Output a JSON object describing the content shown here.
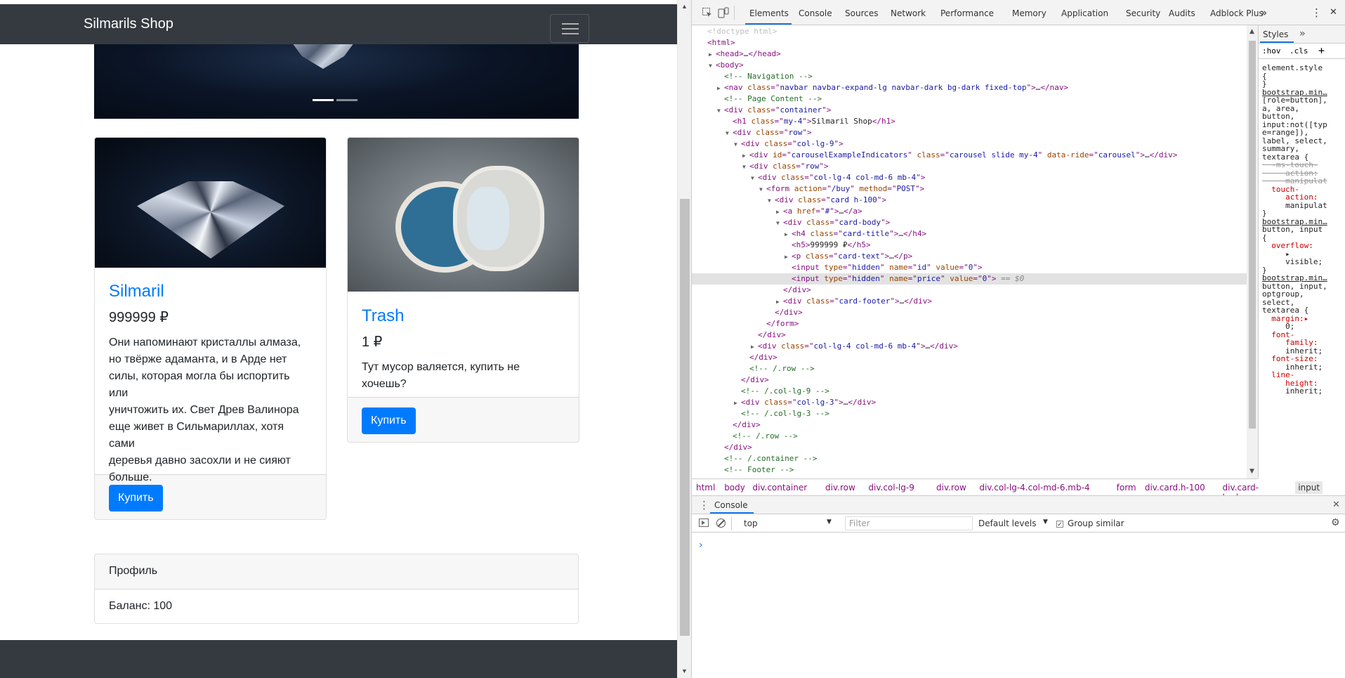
{
  "page": {
    "brand": "Silmarils Shop",
    "products": [
      {
        "title": "Silmaril",
        "price": "999999 ₽",
        "text_lines": [
          "Они напоминают кристаллы алмаза,",
          "но твёрже адаманта, и в Арде нет",
          "силы, которая могла бы испортить или",
          "уничтожить их. Свет Древ Валинора",
          "еще живет в Сильмариллах, хотя сами",
          "деревья давно засохли и не сияют",
          "больше."
        ],
        "buy_label": "Купить"
      },
      {
        "title": "Trash",
        "price": "1 ₽",
        "text_lines": [
          "Тут мусор валяется, купить не хочешь?"
        ],
        "buy_label": "Купить"
      }
    ],
    "profile": {
      "header": "Профиль",
      "balance": "Баланс: 100"
    }
  },
  "devtools": {
    "tabs": [
      "Elements",
      "Console",
      "Sources",
      "Network",
      "Performance",
      "Memory",
      "Application",
      "Security",
      "Audits",
      "Adblock Plus"
    ],
    "more_tabs": "»",
    "menu": "⋮",
    "close": "✕",
    "elements_lines": [
      {
        "tri": "",
        "indent": 0,
        "parts": [
          [
            "doc",
            "<!doctype html>"
          ]
        ]
      },
      {
        "tri": "",
        "indent": 0,
        "parts": [
          [
            "tag",
            "<html>"
          ]
        ]
      },
      {
        "tri": "▶",
        "indent": 1,
        "parts": [
          [
            "tag",
            "<head>"
          ],
          [
            "txt",
            "…"
          ],
          [
            "tag",
            "</head>"
          ]
        ]
      },
      {
        "tri": "▼",
        "indent": 1,
        "parts": [
          [
            "tag",
            "<body>"
          ]
        ]
      },
      {
        "tri": "",
        "indent": 2,
        "parts": [
          [
            "com",
            "<!-- Navigation -->"
          ]
        ]
      },
      {
        "tri": "▶",
        "indent": 2,
        "parts": [
          [
            "tag",
            "<nav "
          ],
          [
            "attr",
            "class"
          ],
          [
            "tag",
            "=\""
          ],
          [
            "val",
            "navbar navbar-expand-lg navbar-dark bg-dark fixed-top"
          ],
          [
            "tag",
            "\">"
          ],
          [
            "txt",
            "…"
          ],
          [
            "tag",
            "</nav>"
          ]
        ]
      },
      {
        "tri": "",
        "indent": 2,
        "parts": [
          [
            "com",
            "<!-- Page Content -->"
          ]
        ]
      },
      {
        "tri": "▼",
        "indent": 2,
        "parts": [
          [
            "tag",
            "<div "
          ],
          [
            "attr",
            "class"
          ],
          [
            "tag",
            "=\""
          ],
          [
            "val",
            "container"
          ],
          [
            "tag",
            "\">"
          ]
        ]
      },
      {
        "tri": "",
        "indent": 3,
        "parts": [
          [
            "tag",
            "<h1 "
          ],
          [
            "attr",
            "class"
          ],
          [
            "tag",
            "=\""
          ],
          [
            "val",
            "my-4"
          ],
          [
            "tag",
            "\">"
          ],
          [
            "txt",
            "Silmaril Shop"
          ],
          [
            "tag",
            "</h1>"
          ]
        ]
      },
      {
        "tri": "▼",
        "indent": 3,
        "parts": [
          [
            "tag",
            "<div "
          ],
          [
            "attr",
            "class"
          ],
          [
            "tag",
            "=\""
          ],
          [
            "val",
            "row"
          ],
          [
            "tag",
            "\">"
          ]
        ]
      },
      {
        "tri": "▼",
        "indent": 4,
        "parts": [
          [
            "tag",
            "<div "
          ],
          [
            "attr",
            "class"
          ],
          [
            "tag",
            "=\""
          ],
          [
            "val",
            "col-lg-9"
          ],
          [
            "tag",
            "\">"
          ]
        ]
      },
      {
        "tri": "▶",
        "indent": 5,
        "parts": [
          [
            "tag",
            "<div "
          ],
          [
            "attr",
            "id"
          ],
          [
            "tag",
            "=\""
          ],
          [
            "val",
            "carouselExampleIndicators"
          ],
          [
            "tag",
            "\" "
          ],
          [
            "attr",
            "class"
          ],
          [
            "tag",
            "=\""
          ],
          [
            "val",
            "carousel slide my-4"
          ],
          [
            "tag",
            "\" "
          ],
          [
            "attr",
            "data-ride"
          ],
          [
            "tag",
            "=\""
          ],
          [
            "val",
            "carousel"
          ],
          [
            "tag",
            "\">"
          ],
          [
            "txt",
            "…"
          ],
          [
            "tag",
            "</div>"
          ]
        ]
      },
      {
        "tri": "▼",
        "indent": 5,
        "parts": [
          [
            "tag",
            "<div "
          ],
          [
            "attr",
            "class"
          ],
          [
            "tag",
            "=\""
          ],
          [
            "val",
            "row"
          ],
          [
            "tag",
            "\">"
          ]
        ]
      },
      {
        "tri": "▼",
        "indent": 6,
        "parts": [
          [
            "tag",
            "<div "
          ],
          [
            "attr",
            "class"
          ],
          [
            "tag",
            "=\""
          ],
          [
            "val",
            "col-lg-4 col-md-6 mb-4"
          ],
          [
            "tag",
            "\">"
          ]
        ]
      },
      {
        "tri": "▼",
        "indent": 7,
        "parts": [
          [
            "tag",
            "<form "
          ],
          [
            "attr",
            "action"
          ],
          [
            "tag",
            "=\""
          ],
          [
            "val",
            "/buy"
          ],
          [
            "tag",
            "\" "
          ],
          [
            "attr",
            "method"
          ],
          [
            "tag",
            "=\""
          ],
          [
            "val",
            "POST"
          ],
          [
            "tag",
            "\">"
          ]
        ]
      },
      {
        "tri": "▼",
        "indent": 8,
        "parts": [
          [
            "tag",
            "<div "
          ],
          [
            "attr",
            "class"
          ],
          [
            "tag",
            "=\""
          ],
          [
            "val",
            "card h-100"
          ],
          [
            "tag",
            "\">"
          ]
        ]
      },
      {
        "tri": "▶",
        "indent": 9,
        "parts": [
          [
            "tag",
            "<a "
          ],
          [
            "attr",
            "href"
          ],
          [
            "tag",
            "=\""
          ],
          [
            "val",
            "#"
          ],
          [
            "tag",
            "\">"
          ],
          [
            "txt",
            "…"
          ],
          [
            "tag",
            "</a>"
          ]
        ]
      },
      {
        "tri": "▼",
        "indent": 9,
        "parts": [
          [
            "tag",
            "<div "
          ],
          [
            "attr",
            "class"
          ],
          [
            "tag",
            "=\""
          ],
          [
            "val",
            "card-body"
          ],
          [
            "tag",
            "\">"
          ]
        ]
      },
      {
        "tri": "▶",
        "indent": 10,
        "parts": [
          [
            "tag",
            "<h4 "
          ],
          [
            "attr",
            "class"
          ],
          [
            "tag",
            "=\""
          ],
          [
            "val",
            "card-title"
          ],
          [
            "tag",
            "\">"
          ],
          [
            "txt",
            "…"
          ],
          [
            "tag",
            "</h4>"
          ]
        ]
      },
      {
        "tri": "",
        "indent": 10,
        "parts": [
          [
            "tag",
            "<h5>"
          ],
          [
            "txt",
            "999999 ₽"
          ],
          [
            "tag",
            "</h5>"
          ]
        ]
      },
      {
        "tri": "▶",
        "indent": 10,
        "parts": [
          [
            "tag",
            "<p "
          ],
          [
            "attr",
            "class"
          ],
          [
            "tag",
            "=\""
          ],
          [
            "val",
            "card-text"
          ],
          [
            "tag",
            "\">"
          ],
          [
            "txt",
            "…"
          ],
          [
            "tag",
            "</p>"
          ]
        ]
      },
      {
        "tri": "",
        "indent": 10,
        "parts": [
          [
            "tag",
            "<input "
          ],
          [
            "attr",
            "type"
          ],
          [
            "tag",
            "=\""
          ],
          [
            "val",
            "hidden"
          ],
          [
            "tag",
            "\" "
          ],
          [
            "attr",
            "name"
          ],
          [
            "tag",
            "=\""
          ],
          [
            "val",
            "id"
          ],
          [
            "tag",
            "\" "
          ],
          [
            "attr",
            "value"
          ],
          [
            "tag",
            "=\""
          ],
          [
            "val",
            "0"
          ],
          [
            "tag",
            "\">"
          ]
        ]
      },
      {
        "tri": "",
        "indent": 10,
        "sel": true,
        "parts": [
          [
            "tag",
            "<input "
          ],
          [
            "attr",
            "type"
          ],
          [
            "tag",
            "=\""
          ],
          [
            "val",
            "hidden"
          ],
          [
            "tag",
            "\" "
          ],
          [
            "attr",
            "name"
          ],
          [
            "tag",
            "=\""
          ],
          [
            "val",
            "price"
          ],
          [
            "tag",
            "\" "
          ],
          [
            "attr",
            "value"
          ],
          [
            "tag",
            "=\""
          ],
          [
            "val",
            "0"
          ],
          [
            "tag",
            "\">"
          ],
          [
            "eq",
            " == $0"
          ]
        ]
      },
      {
        "tri": "",
        "indent": 9,
        "parts": [
          [
            "tag",
            "</div>"
          ]
        ]
      },
      {
        "tri": "▶",
        "indent": 9,
        "parts": [
          [
            "tag",
            "<div "
          ],
          [
            "attr",
            "class"
          ],
          [
            "tag",
            "=\""
          ],
          [
            "val",
            "card-footer"
          ],
          [
            "tag",
            "\">"
          ],
          [
            "txt",
            "…"
          ],
          [
            "tag",
            "</div>"
          ]
        ]
      },
      {
        "tri": "",
        "indent": 8,
        "parts": [
          [
            "tag",
            "</div>"
          ]
        ]
      },
      {
        "tri": "",
        "indent": 7,
        "parts": [
          [
            "tag",
            "</form>"
          ]
        ]
      },
      {
        "tri": "",
        "indent": 6,
        "parts": [
          [
            "tag",
            "</div>"
          ]
        ]
      },
      {
        "tri": "▶",
        "indent": 6,
        "parts": [
          [
            "tag",
            "<div "
          ],
          [
            "attr",
            "class"
          ],
          [
            "tag",
            "=\""
          ],
          [
            "val",
            "col-lg-4 col-md-6 mb-4"
          ],
          [
            "tag",
            "\">"
          ],
          [
            "txt",
            "…"
          ],
          [
            "tag",
            "</div>"
          ]
        ]
      },
      {
        "tri": "",
        "indent": 5,
        "parts": [
          [
            "tag",
            "</div>"
          ]
        ]
      },
      {
        "tri": "",
        "indent": 5,
        "parts": [
          [
            "com",
            "<!-- /.row -->"
          ]
        ]
      },
      {
        "tri": "",
        "indent": 4,
        "parts": [
          [
            "tag",
            "</div>"
          ]
        ]
      },
      {
        "tri": "",
        "indent": 4,
        "parts": [
          [
            "com",
            "<!-- /.col-lg-9 -->"
          ]
        ]
      },
      {
        "tri": "▶",
        "indent": 4,
        "parts": [
          [
            "tag",
            "<div "
          ],
          [
            "attr",
            "class"
          ],
          [
            "tag",
            "=\""
          ],
          [
            "val",
            "col-lg-3"
          ],
          [
            "tag",
            "\">"
          ],
          [
            "txt",
            "…"
          ],
          [
            "tag",
            "</div>"
          ]
        ]
      },
      {
        "tri": "",
        "indent": 4,
        "parts": [
          [
            "com",
            "<!-- /.col-lg-3 -->"
          ]
        ]
      },
      {
        "tri": "",
        "indent": 3,
        "parts": [
          [
            "tag",
            "</div>"
          ]
        ]
      },
      {
        "tri": "",
        "indent": 3,
        "parts": [
          [
            "com",
            "<!-- /.row -->"
          ]
        ]
      },
      {
        "tri": "",
        "indent": 2,
        "parts": [
          [
            "tag",
            "</div>"
          ]
        ]
      },
      {
        "tri": "",
        "indent": 2,
        "parts": [
          [
            "com",
            "<!-- /.container -->"
          ]
        ]
      },
      {
        "tri": "",
        "indent": 2,
        "parts": [
          [
            "com",
            "<!-- Footer -->"
          ]
        ]
      }
    ],
    "styles": {
      "tab": "Styles",
      "more": "»",
      "hov": ":hov",
      "cls": ".cls",
      "plus": "+"
    },
    "style_lines": [
      [
        "txt",
        "element.style"
      ],
      [
        "txt",
        "{"
      ],
      [
        "txt",
        "}"
      ],
      [
        "link",
        "bootstrap.min…"
      ],
      [
        "txt",
        "[role=button],"
      ],
      [
        "txt",
        "a, area,"
      ],
      [
        "txt",
        "button,"
      ],
      [
        "txt",
        "input:not([typ"
      ],
      [
        "txt",
        "e=range]),"
      ],
      [
        "txt",
        "label, select,"
      ],
      [
        "txt",
        "summary,"
      ],
      [
        "txt",
        "textarea {"
      ],
      [
        "strike",
        "  -ms-touch-"
      ],
      [
        "strike",
        "     action:"
      ],
      [
        "strike",
        "     manipulat"
      ],
      [
        "prop",
        "  touch-"
      ],
      [
        "prop",
        "     action:"
      ],
      [
        "txt",
        "     manipulat"
      ],
      [
        "txt",
        "}"
      ],
      [
        "link",
        "bootstrap.min…"
      ],
      [
        "txt",
        "button, input"
      ],
      [
        "txt",
        "{"
      ],
      [
        "prop",
        "  overflow:"
      ],
      [
        "txt",
        "     ▸"
      ],
      [
        "txt",
        "     visible;"
      ],
      [
        "txt",
        "}"
      ],
      [
        "link",
        "bootstrap.min…"
      ],
      [
        "txt",
        "button, input,"
      ],
      [
        "txt",
        "optgroup,"
      ],
      [
        "txt",
        "select,"
      ],
      [
        "txt",
        "textarea {"
      ],
      [
        "prop",
        "  margin:▸"
      ],
      [
        "txt",
        "     0;"
      ],
      [
        "prop",
        "  font-"
      ],
      [
        "prop",
        "     family:"
      ],
      [
        "txt",
        "     inherit;"
      ],
      [
        "prop",
        "  font-size:"
      ],
      [
        "txt",
        "     inherit;"
      ],
      [
        "prop",
        "  line-"
      ],
      [
        "prop",
        "     height:"
      ],
      [
        "txt",
        "     inherit;"
      ]
    ],
    "breadcrumb": [
      "html",
      "body",
      "div.container",
      "div.row",
      "div.col-lg-9",
      "div.row",
      "div.col-lg-4.col-md-6.mb-4",
      "form",
      "div.card.h-100",
      "div.card-body",
      "input"
    ],
    "console": {
      "tab": "Console",
      "context": "top",
      "filter_placeholder": "Filter",
      "levels": "Default levels",
      "group_similar": "Group similar",
      "prompt": "›"
    }
  }
}
